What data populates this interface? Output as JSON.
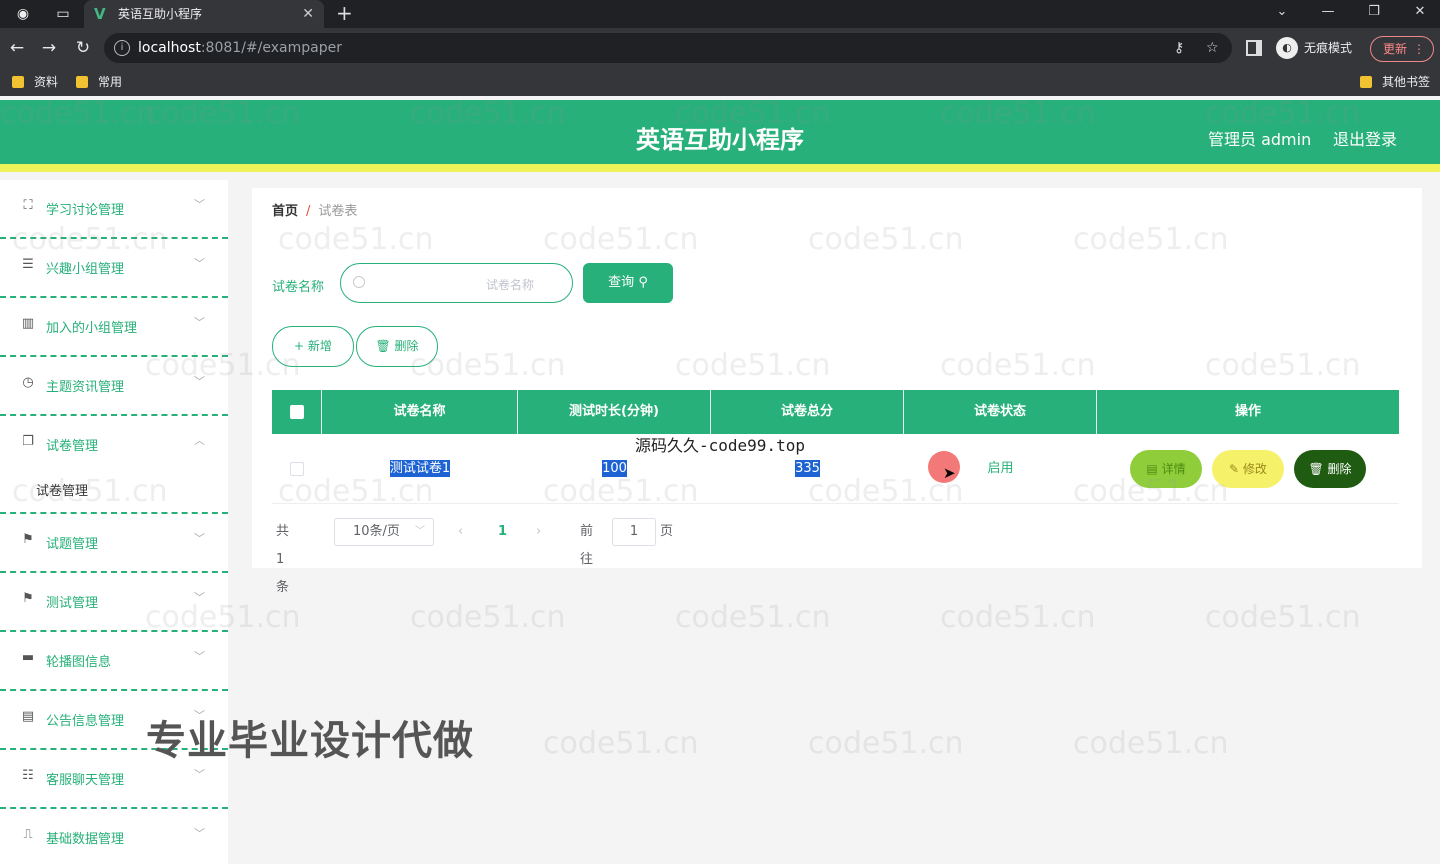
{
  "browser": {
    "tab_title": "英语互助小程序",
    "url_host": "localhost",
    "url_path": ":8081/#/exampaper",
    "incognito_label": "无痕模式",
    "update_label": "更新",
    "bookmarks": [
      "资料",
      "常用"
    ],
    "other_bookmarks": "其他书签"
  },
  "header": {
    "title": "英语互助小程序",
    "user": "管理员 admin",
    "logout": "退出登录"
  },
  "sidebar": {
    "items": [
      {
        "label": "学习讨论管理",
        "icon": "expand-icon"
      },
      {
        "label": "兴趣小组管理",
        "icon": "list-icon"
      },
      {
        "label": "加入的小组管理",
        "icon": "library-icon"
      },
      {
        "label": "主题资讯管理",
        "icon": "clock-icon"
      },
      {
        "label": "试卷管理",
        "icon": "copy-icon"
      },
      {
        "label": "试题管理",
        "icon": "flag-icon"
      },
      {
        "label": "测试管理",
        "icon": "flag-icon"
      },
      {
        "label": "轮播图信息",
        "icon": "monitor-icon"
      },
      {
        "label": "公告信息管理",
        "icon": "news-icon"
      },
      {
        "label": "客服聊天管理",
        "icon": "sliders-icon"
      },
      {
        "label": "基础数据管理",
        "icon": "stamp-icon"
      }
    ],
    "sub_item": "试卷管理"
  },
  "breadcrumb": {
    "home": "首页",
    "separator": "/",
    "current": "试卷表"
  },
  "search": {
    "label": "试卷名称",
    "placeholder": "试卷名称",
    "button": "查询"
  },
  "actions": {
    "add": "新增",
    "delete": "删除"
  },
  "table": {
    "columns": [
      "试卷名称",
      "测试时长(分钟)",
      "试卷总分",
      "试卷状态",
      "操作"
    ],
    "rows": [
      {
        "name": "测试试卷1",
        "duration": "100",
        "score": "335",
        "status": "启用"
      }
    ],
    "row_actions": {
      "detail": "详情",
      "edit": "修改",
      "delete": "删除"
    }
  },
  "pager": {
    "total": "共 1 条",
    "page_size": "10条/页",
    "current_page": "1",
    "goto_label": "前往",
    "goto_value": "1",
    "page_unit": "页"
  },
  "overlays": {
    "watermark": "code51.cn",
    "site": "源码久久-code99.top",
    "ad": "专业毕业设计代做"
  },
  "colors": {
    "primary": "#27b07a",
    "accent_bar": "#eef35a",
    "detail_btn": "#8fce3a",
    "edit_btn": "#f5f26a",
    "delete_btn": "#1f5c12"
  }
}
